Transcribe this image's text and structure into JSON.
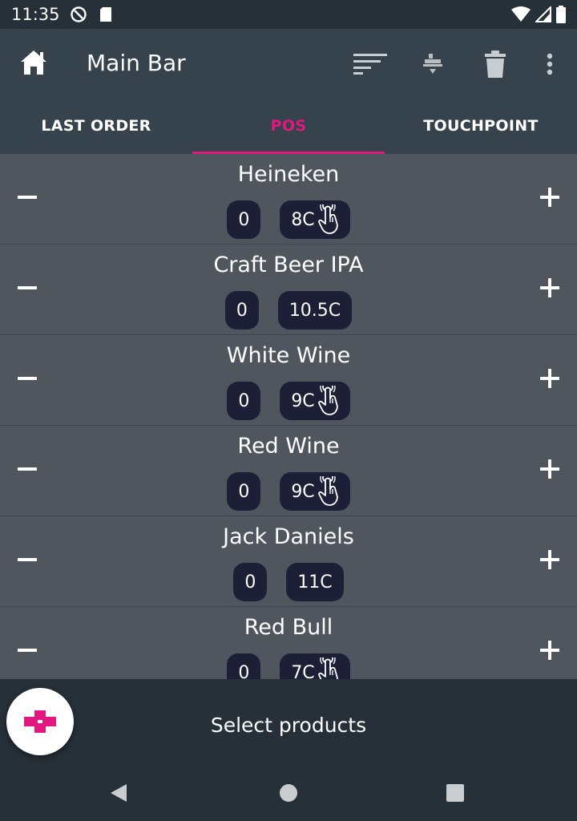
{
  "status": {
    "time": "11:35"
  },
  "appbar": {
    "title": "Main Bar"
  },
  "tabs": [
    {
      "label": "LAST ORDER",
      "active": false
    },
    {
      "label": "POS",
      "active": true
    },
    {
      "label": "TOUCHPOINT",
      "active": false
    }
  ],
  "products": [
    {
      "name": "Heineken",
      "qty": "0",
      "price": "8C",
      "touch": true
    },
    {
      "name": "Craft Beer IPA",
      "qty": "0",
      "price": "10.5C",
      "touch": false
    },
    {
      "name": "White Wine",
      "qty": "0",
      "price": "9C",
      "touch": true
    },
    {
      "name": "Red Wine",
      "qty": "0",
      "price": "9C",
      "touch": true
    },
    {
      "name": "Jack Daniels",
      "qty": "0",
      "price": "11C",
      "touch": false
    },
    {
      "name": "Red Bull",
      "qty": "0",
      "price": "7C",
      "touch": true
    }
  ],
  "footer": {
    "label": "Select products"
  },
  "colors": {
    "accent": "#e0187f",
    "bar": "#36434c",
    "list_bg": "#4f565d",
    "chip": "#1c1f36"
  }
}
